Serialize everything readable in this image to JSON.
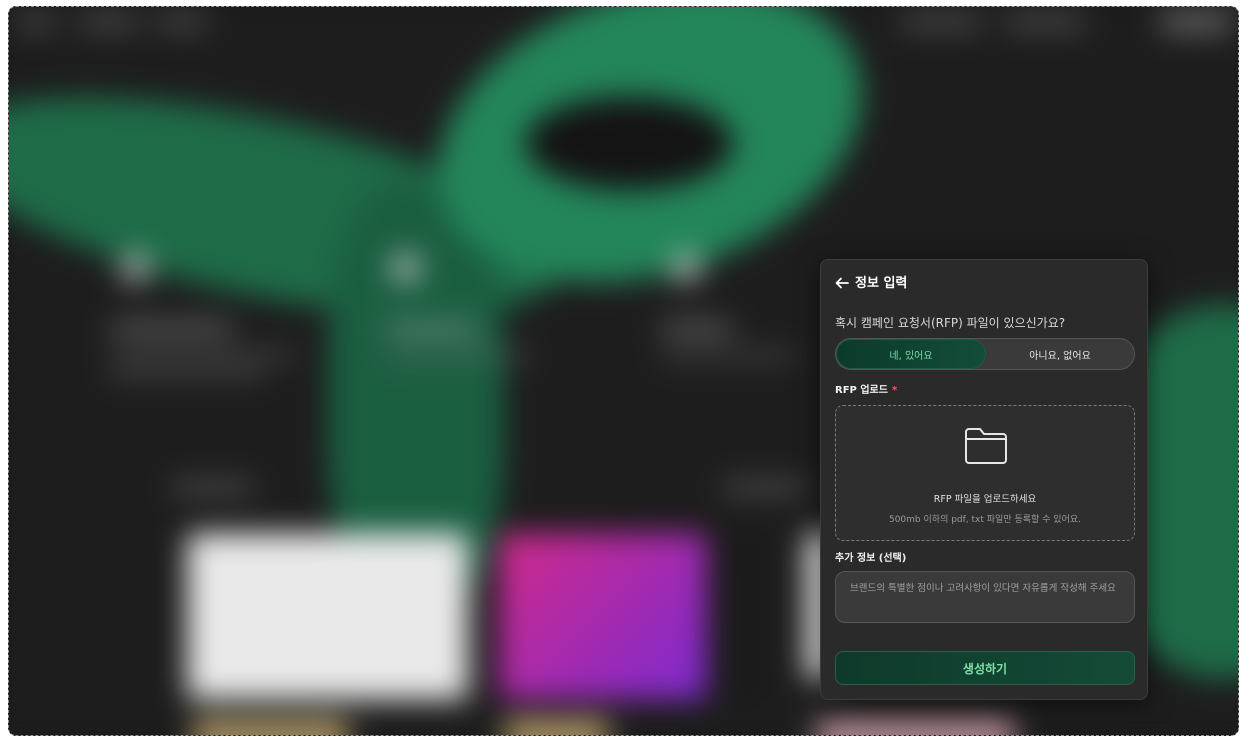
{
  "panel": {
    "title": "정보 입력",
    "question": "혹시 캠페인 요청서(RFP) 파일이 있으신가요?",
    "toggle": {
      "yes_label": "네, 있어요",
      "no_label": "아니요, 없어요",
      "selected": "yes"
    },
    "rfp_upload": {
      "label": "RFP 업로드",
      "required_mark": "*",
      "dropzone_main": "RFP 파일을 업로드하세요",
      "dropzone_sub": "500mb 이하의 pdf, txt 파일만 등록할 수 있어요."
    },
    "extra_info": {
      "label": "추가 정보 (선택)",
      "placeholder": "브랜드의 특별한 점이나 고려사항이 있다면 자유롭게 작성해 주세요"
    },
    "submit_label": "생성하기"
  },
  "colors": {
    "accent": "#7fe0a8",
    "panel_bg": "#2a2a2a",
    "required": "#ff5a5a"
  },
  "icons": [
    "arrow-left-icon",
    "folder-icon"
  ]
}
